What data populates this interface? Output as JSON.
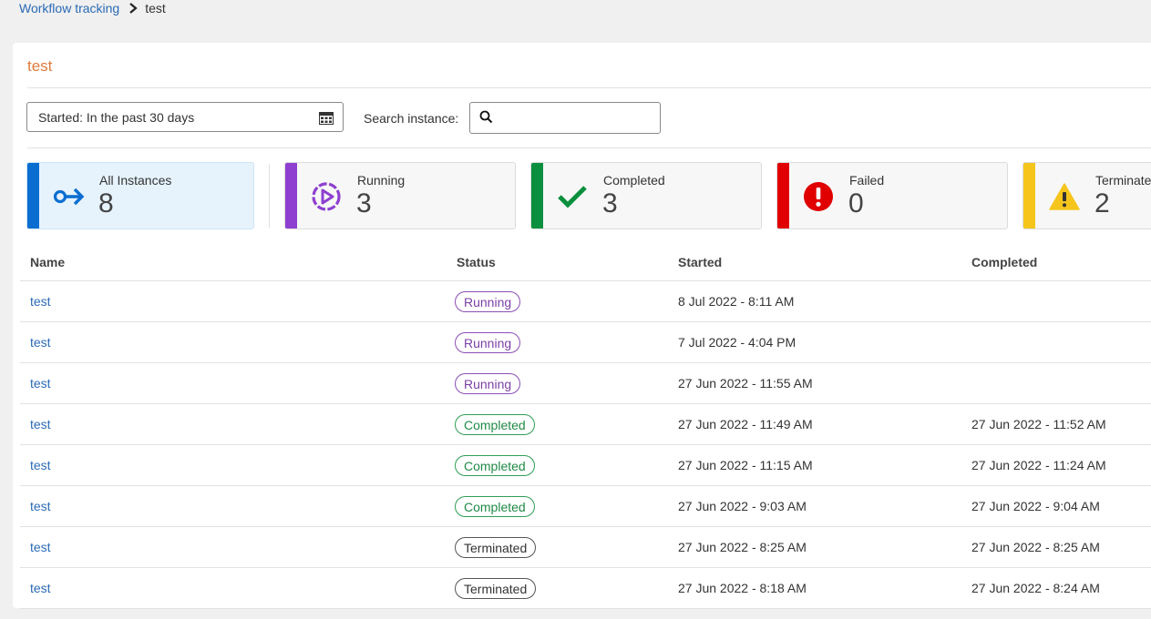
{
  "breadcrumb": {
    "parent": "Workflow tracking",
    "current": "test"
  },
  "page": {
    "title": "test"
  },
  "filters": {
    "date_range": "Started: In the past 30 days",
    "search_label": "Search instance:",
    "search_value": ""
  },
  "summary": [
    {
      "key": "all",
      "label": "All Instances",
      "count": "8",
      "color": "#0a6ed1",
      "icon": "arrow-enter-icon"
    },
    {
      "key": "running",
      "label": "Running",
      "count": "3",
      "color": "#8e3fd0",
      "icon": "play-circle-icon"
    },
    {
      "key": "completed",
      "label": "Completed",
      "count": "3",
      "color": "#0a8f3e",
      "icon": "checkmark-icon"
    },
    {
      "key": "failed",
      "label": "Failed",
      "count": "0",
      "color": "#e00000",
      "icon": "error-circle-icon"
    },
    {
      "key": "terminated",
      "label": "Terminated",
      "count": "2",
      "color": "#f5c51c",
      "icon": "warning-triangle-icon"
    }
  ],
  "table": {
    "headers": {
      "name": "Name",
      "status": "Status",
      "started": "Started",
      "completed": "Completed"
    },
    "rows": [
      {
        "name": "test",
        "status": "Running",
        "started": "8 Jul 2022 - 8:11 AM",
        "completed": ""
      },
      {
        "name": "test",
        "status": "Running",
        "started": "7 Jul 2022 - 4:04 PM",
        "completed": ""
      },
      {
        "name": "test",
        "status": "Running",
        "started": "27 Jun 2022 - 11:55 AM",
        "completed": ""
      },
      {
        "name": "test",
        "status": "Completed",
        "started": "27 Jun 2022 - 11:49 AM",
        "completed": "27 Jun 2022 - 11:52 AM"
      },
      {
        "name": "test",
        "status": "Completed",
        "started": "27 Jun 2022 - 11:15 AM",
        "completed": "27 Jun 2022 - 11:24 AM"
      },
      {
        "name": "test",
        "status": "Completed",
        "started": "27 Jun 2022 - 9:03 AM",
        "completed": "27 Jun 2022 - 9:04 AM"
      },
      {
        "name": "test",
        "status": "Terminated",
        "started": "27 Jun 2022 - 8:25 AM",
        "completed": "27 Jun 2022 - 8:25 AM"
      },
      {
        "name": "test",
        "status": "Terminated",
        "started": "27 Jun 2022 - 8:18 AM",
        "completed": "27 Jun 2022 - 8:24 AM"
      }
    ]
  }
}
